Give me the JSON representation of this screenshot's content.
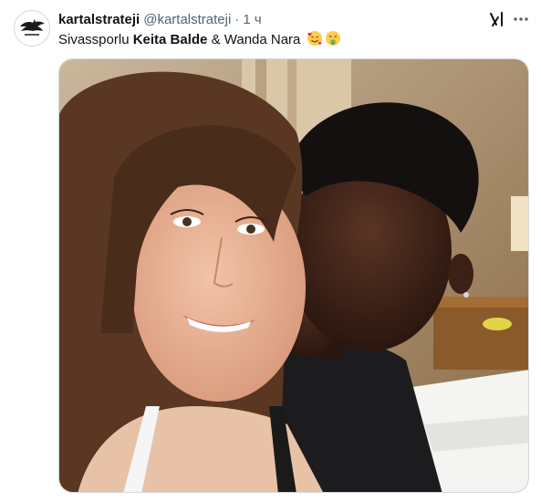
{
  "tweet": {
    "display_name": "kartalstrateji",
    "handle": "@kartalstrateji",
    "separator": "·",
    "time": "1 ч",
    "text_part1": "Sivassporlu ",
    "text_bold": "Keita Balde",
    "text_part2": " & Wanda Nara",
    "emojis": [
      "smiling-face-with-hearts",
      "face-vomiting"
    ]
  },
  "icons": {
    "grok": "grok-icon",
    "more": "more-dots-icon"
  },
  "colors": {
    "text": "#0f1419",
    "secondary": "#536471",
    "border": "#cfd9de"
  }
}
